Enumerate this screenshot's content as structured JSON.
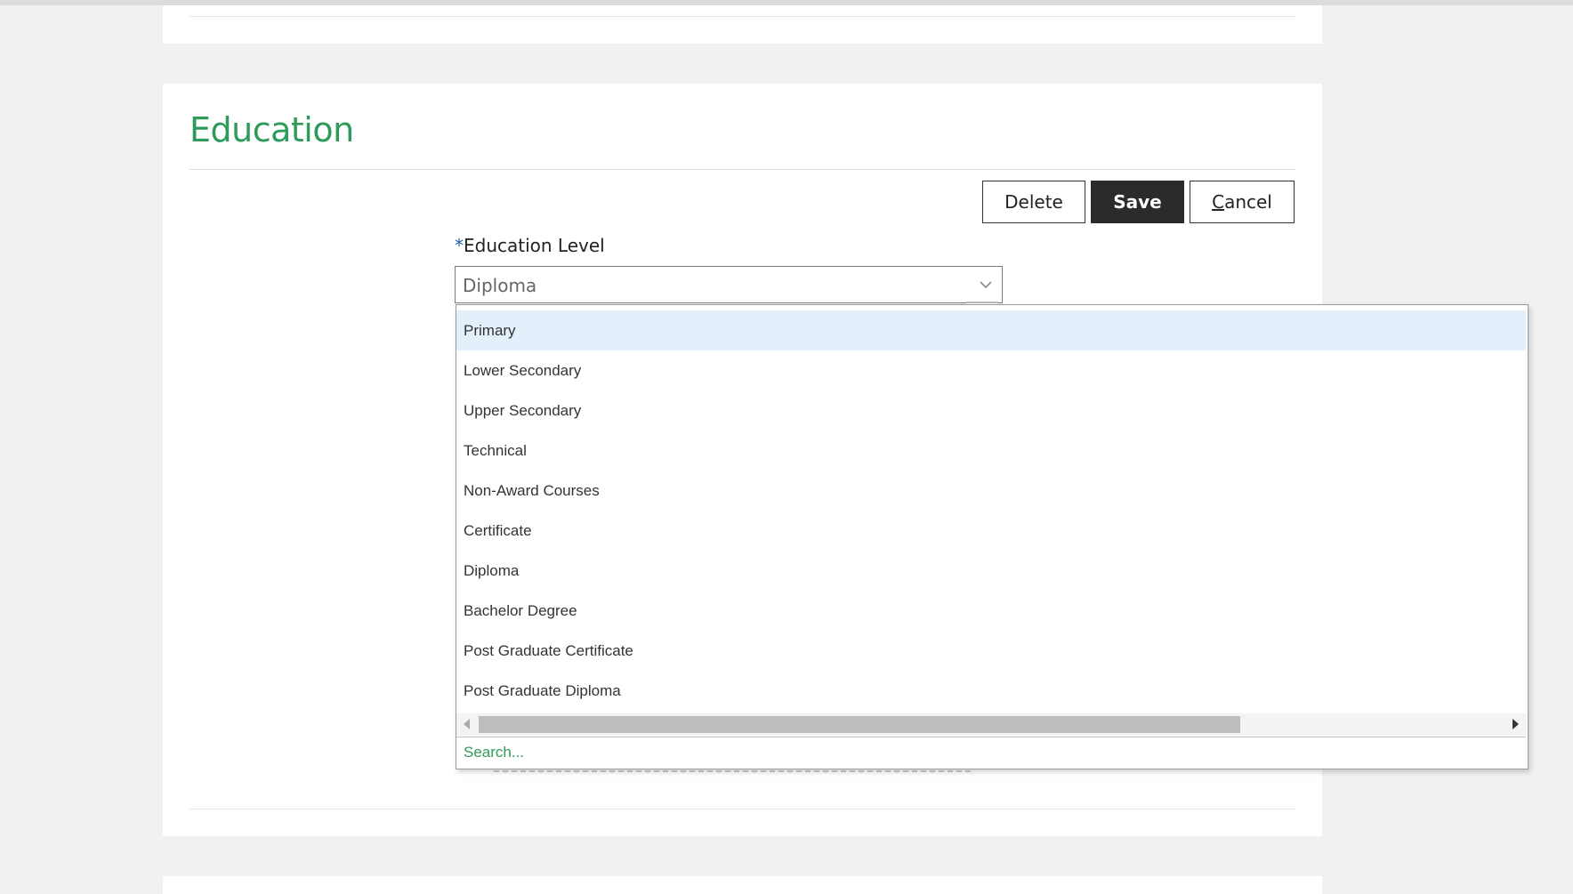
{
  "section": {
    "title": "Education"
  },
  "actions": {
    "delete_label": "Delete",
    "save_label": "Save",
    "cancel_first": "C",
    "cancel_rest": "ancel"
  },
  "field": {
    "required_mark": "*",
    "label": "Education Level",
    "value": "Diploma"
  },
  "dropdown": {
    "highlighted_index": 0,
    "options": [
      "Primary",
      "Lower Secondary",
      "Upper Secondary",
      "Technical",
      "Non-Award Courses",
      "Certificate",
      "Diploma",
      "Bachelor Degree",
      "Post Graduate Certificate",
      "Post Graduate Diploma"
    ],
    "search_placeholder": "Search..."
  },
  "colors": {
    "accent_green": "#2e9b5a",
    "highlight": "#e3f0fb",
    "required_blue": "#1f5fa8",
    "save_bg": "#2b2b2b"
  },
  "icons": {
    "select": "chevron-down-icon",
    "scroll_left": "caret-left-icon",
    "scroll_right": "caret-right-icon"
  }
}
